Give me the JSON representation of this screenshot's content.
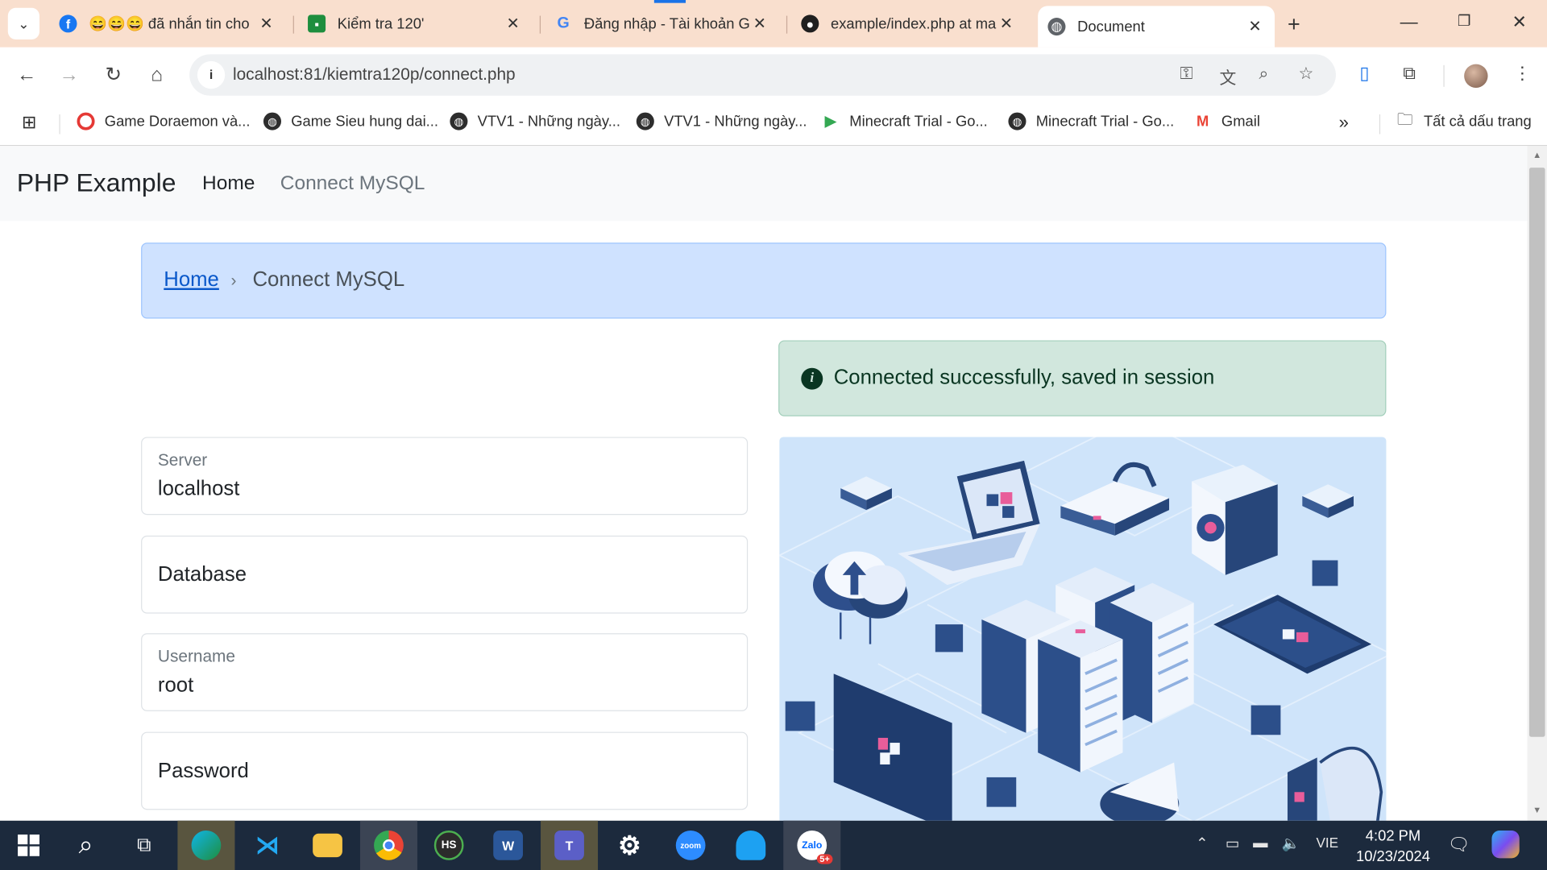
{
  "browser": {
    "tabs": [
      {
        "title": "😄😄😄 đã nhắn tin cho",
        "icon": "facebook-icon"
      },
      {
        "title": "Kiểm tra 120'",
        "icon": "google-classroom-icon"
      },
      {
        "title": "Đăng nhập - Tài khoản G",
        "icon": "google-icon"
      },
      {
        "title": "example/index.php at ma",
        "icon": "github-icon"
      },
      {
        "title": "Document",
        "icon": "globe-icon"
      }
    ],
    "new_tab": "+",
    "url": "localhost:81/kiemtra120p/connect.php",
    "bookmarks": [
      "Game Doraemon và...",
      "Game Sieu hung dai...",
      "VTV1 - Những ngày...",
      "VTV1 - Những ngày...",
      "Minecraft Trial - Go...",
      "Minecraft Trial - Go...",
      "Gmail"
    ],
    "all_bookmarks": "Tất cả dấu trang",
    "more_bookmarks": "»"
  },
  "navbar": {
    "brand": "PHP Example",
    "links": [
      "Home",
      "Connect MySQL"
    ]
  },
  "breadcrumb": {
    "home": "Home",
    "separator": "›",
    "current": "Connect MySQL"
  },
  "alert": {
    "icon": "i",
    "message": "Connected successfully, saved in session",
    "color": "#d1e7dd"
  },
  "form": {
    "server": {
      "label": "Server",
      "value": "localhost"
    },
    "database": {
      "label": "Database"
    },
    "username": {
      "label": "Username",
      "value": "root"
    },
    "password": {
      "label": "Password"
    }
  },
  "taskbar": {
    "apps": [
      "start",
      "search",
      "task-view",
      "edge",
      "vscode",
      "file-explorer",
      "chrome",
      "hs",
      "word",
      "teams",
      "settings",
      "zoom",
      "app-blue",
      "zalo"
    ],
    "word_label": "W",
    "hs_label": "HS",
    "zoom_label": "zoom",
    "zalo_badge": "5+",
    "language": "VIE",
    "time": "4:02 PM",
    "date": "10/23/2024"
  }
}
